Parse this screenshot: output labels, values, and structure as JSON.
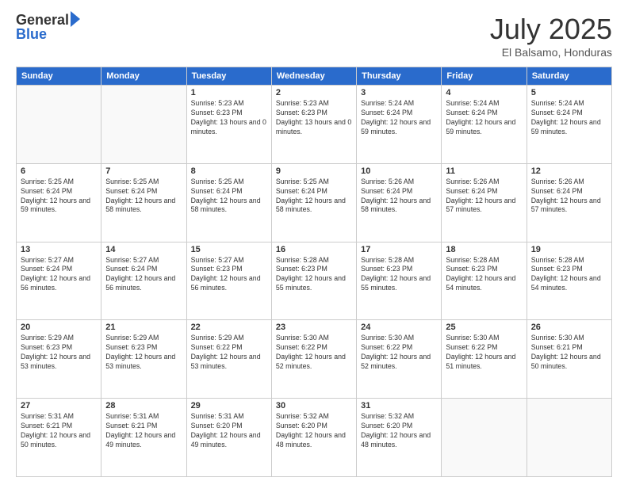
{
  "logo": {
    "general": "General",
    "blue": "Blue"
  },
  "title": "July 2025",
  "subtitle": "El Balsamo, Honduras",
  "days_of_week": [
    "Sunday",
    "Monday",
    "Tuesday",
    "Wednesday",
    "Thursday",
    "Friday",
    "Saturday"
  ],
  "weeks": [
    [
      {
        "day": "",
        "info": ""
      },
      {
        "day": "",
        "info": ""
      },
      {
        "day": "1",
        "info": "Sunrise: 5:23 AM\nSunset: 6:23 PM\nDaylight: 13 hours and 0 minutes."
      },
      {
        "day": "2",
        "info": "Sunrise: 5:23 AM\nSunset: 6:23 PM\nDaylight: 13 hours and 0 minutes."
      },
      {
        "day": "3",
        "info": "Sunrise: 5:24 AM\nSunset: 6:24 PM\nDaylight: 12 hours and 59 minutes."
      },
      {
        "day": "4",
        "info": "Sunrise: 5:24 AM\nSunset: 6:24 PM\nDaylight: 12 hours and 59 minutes."
      },
      {
        "day": "5",
        "info": "Sunrise: 5:24 AM\nSunset: 6:24 PM\nDaylight: 12 hours and 59 minutes."
      }
    ],
    [
      {
        "day": "6",
        "info": "Sunrise: 5:25 AM\nSunset: 6:24 PM\nDaylight: 12 hours and 59 minutes."
      },
      {
        "day": "7",
        "info": "Sunrise: 5:25 AM\nSunset: 6:24 PM\nDaylight: 12 hours and 58 minutes."
      },
      {
        "day": "8",
        "info": "Sunrise: 5:25 AM\nSunset: 6:24 PM\nDaylight: 12 hours and 58 minutes."
      },
      {
        "day": "9",
        "info": "Sunrise: 5:25 AM\nSunset: 6:24 PM\nDaylight: 12 hours and 58 minutes."
      },
      {
        "day": "10",
        "info": "Sunrise: 5:26 AM\nSunset: 6:24 PM\nDaylight: 12 hours and 58 minutes."
      },
      {
        "day": "11",
        "info": "Sunrise: 5:26 AM\nSunset: 6:24 PM\nDaylight: 12 hours and 57 minutes."
      },
      {
        "day": "12",
        "info": "Sunrise: 5:26 AM\nSunset: 6:24 PM\nDaylight: 12 hours and 57 minutes."
      }
    ],
    [
      {
        "day": "13",
        "info": "Sunrise: 5:27 AM\nSunset: 6:24 PM\nDaylight: 12 hours and 56 minutes."
      },
      {
        "day": "14",
        "info": "Sunrise: 5:27 AM\nSunset: 6:24 PM\nDaylight: 12 hours and 56 minutes."
      },
      {
        "day": "15",
        "info": "Sunrise: 5:27 AM\nSunset: 6:23 PM\nDaylight: 12 hours and 56 minutes."
      },
      {
        "day": "16",
        "info": "Sunrise: 5:28 AM\nSunset: 6:23 PM\nDaylight: 12 hours and 55 minutes."
      },
      {
        "day": "17",
        "info": "Sunrise: 5:28 AM\nSunset: 6:23 PM\nDaylight: 12 hours and 55 minutes."
      },
      {
        "day": "18",
        "info": "Sunrise: 5:28 AM\nSunset: 6:23 PM\nDaylight: 12 hours and 54 minutes."
      },
      {
        "day": "19",
        "info": "Sunrise: 5:28 AM\nSunset: 6:23 PM\nDaylight: 12 hours and 54 minutes."
      }
    ],
    [
      {
        "day": "20",
        "info": "Sunrise: 5:29 AM\nSunset: 6:23 PM\nDaylight: 12 hours and 53 minutes."
      },
      {
        "day": "21",
        "info": "Sunrise: 5:29 AM\nSunset: 6:23 PM\nDaylight: 12 hours and 53 minutes."
      },
      {
        "day": "22",
        "info": "Sunrise: 5:29 AM\nSunset: 6:22 PM\nDaylight: 12 hours and 53 minutes."
      },
      {
        "day": "23",
        "info": "Sunrise: 5:30 AM\nSunset: 6:22 PM\nDaylight: 12 hours and 52 minutes."
      },
      {
        "day": "24",
        "info": "Sunrise: 5:30 AM\nSunset: 6:22 PM\nDaylight: 12 hours and 52 minutes."
      },
      {
        "day": "25",
        "info": "Sunrise: 5:30 AM\nSunset: 6:22 PM\nDaylight: 12 hours and 51 minutes."
      },
      {
        "day": "26",
        "info": "Sunrise: 5:30 AM\nSunset: 6:21 PM\nDaylight: 12 hours and 50 minutes."
      }
    ],
    [
      {
        "day": "27",
        "info": "Sunrise: 5:31 AM\nSunset: 6:21 PM\nDaylight: 12 hours and 50 minutes."
      },
      {
        "day": "28",
        "info": "Sunrise: 5:31 AM\nSunset: 6:21 PM\nDaylight: 12 hours and 49 minutes."
      },
      {
        "day": "29",
        "info": "Sunrise: 5:31 AM\nSunset: 6:20 PM\nDaylight: 12 hours and 49 minutes."
      },
      {
        "day": "30",
        "info": "Sunrise: 5:32 AM\nSunset: 6:20 PM\nDaylight: 12 hours and 48 minutes."
      },
      {
        "day": "31",
        "info": "Sunrise: 5:32 AM\nSunset: 6:20 PM\nDaylight: 12 hours and 48 minutes."
      },
      {
        "day": "",
        "info": ""
      },
      {
        "day": "",
        "info": ""
      }
    ]
  ]
}
